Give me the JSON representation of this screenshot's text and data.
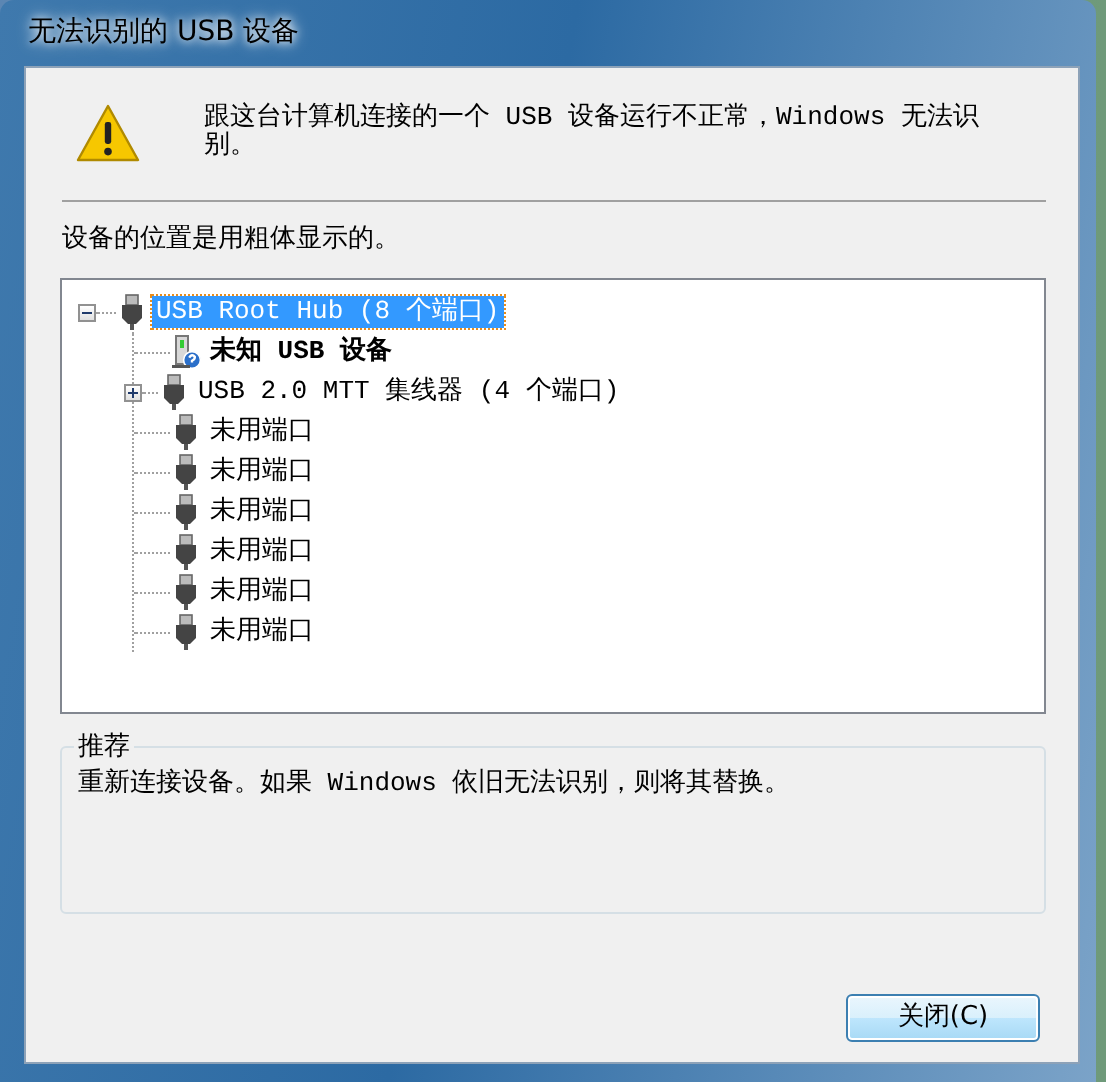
{
  "window": {
    "title": "无法识别的 USB 设备"
  },
  "message": "跟这台计算机连接的一个 USB 设备运行不正常，Windows 无法识别。",
  "hint": "设备的位置是用粗体显示的。",
  "tree": [
    {
      "label": "USB Root Hub (8 个端口)",
      "kind": "usb",
      "selected": true,
      "bold": false,
      "expanded": true,
      "children": [
        {
          "label": "未知 USB 设备",
          "kind": "unknown",
          "selected": false,
          "bold": true
        },
        {
          "label": "USB 2.0 MTT 集线器 (4 个端口)",
          "kind": "usb",
          "selected": false,
          "bold": false,
          "expanded": false
        },
        {
          "label": "未用端口",
          "kind": "port",
          "selected": false,
          "bold": false
        },
        {
          "label": "未用端口",
          "kind": "port",
          "selected": false,
          "bold": false
        },
        {
          "label": "未用端口",
          "kind": "port",
          "selected": false,
          "bold": false
        },
        {
          "label": "未用端口",
          "kind": "port",
          "selected": false,
          "bold": false
        },
        {
          "label": "未用端口",
          "kind": "port",
          "selected": false,
          "bold": false
        },
        {
          "label": "未用端口",
          "kind": "port",
          "selected": false,
          "bold": false
        }
      ]
    }
  ],
  "recommendation": {
    "title": "推荐",
    "text": "重新连接设备。如果 Windows 依旧无法识别，则将其替换。"
  },
  "buttons": [
    {
      "label": "关闭(C)"
    }
  ]
}
